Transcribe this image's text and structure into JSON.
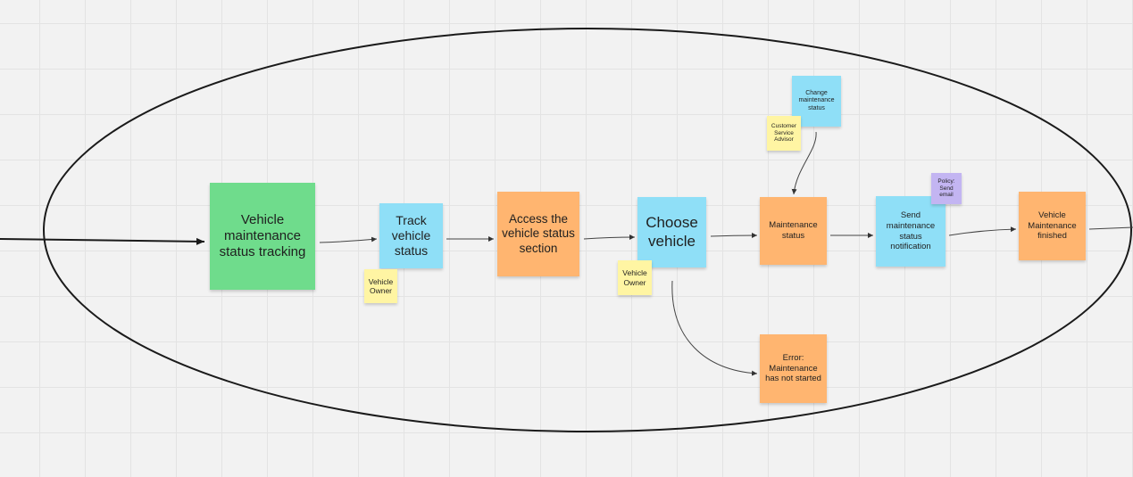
{
  "diagram": {
    "nodes": {
      "vehicle_tracking": "Vehicle maintenance status tracking",
      "track_status": "Track vehicle status",
      "access_section": "Access the vehicle status section",
      "choose_vehicle": "Choose vehicle",
      "maintenance_status": "Maintenance status",
      "send_notification": "Send maintenance status notification",
      "maintenance_finished": "Vehicle Maintenance finished",
      "change_status": "Change maintenance status",
      "error": "Error: Maintenance has not started",
      "owner_1": "Vehicle Owner",
      "owner_2": "Vehicle Owner",
      "csa": "Customer Service Advisor",
      "policy": "Policy: Send email"
    },
    "colors": {
      "event": "#ffb570",
      "command": "#8fdff7",
      "actor": "#fff5a3",
      "policy": "#c3b5f2",
      "goal": "#6fdc8c"
    },
    "edges": [
      {
        "from": "vehicle_tracking",
        "to": "track_status"
      },
      {
        "from": "track_status",
        "to": "access_section"
      },
      {
        "from": "access_section",
        "to": "choose_vehicle"
      },
      {
        "from": "choose_vehicle",
        "to": "maintenance_status"
      },
      {
        "from": "maintenance_status",
        "to": "send_notification"
      },
      {
        "from": "send_notification",
        "to": "maintenance_finished"
      },
      {
        "from": "change_status",
        "to": "maintenance_status"
      },
      {
        "from": "choose_vehicle",
        "to": "error"
      }
    ]
  }
}
